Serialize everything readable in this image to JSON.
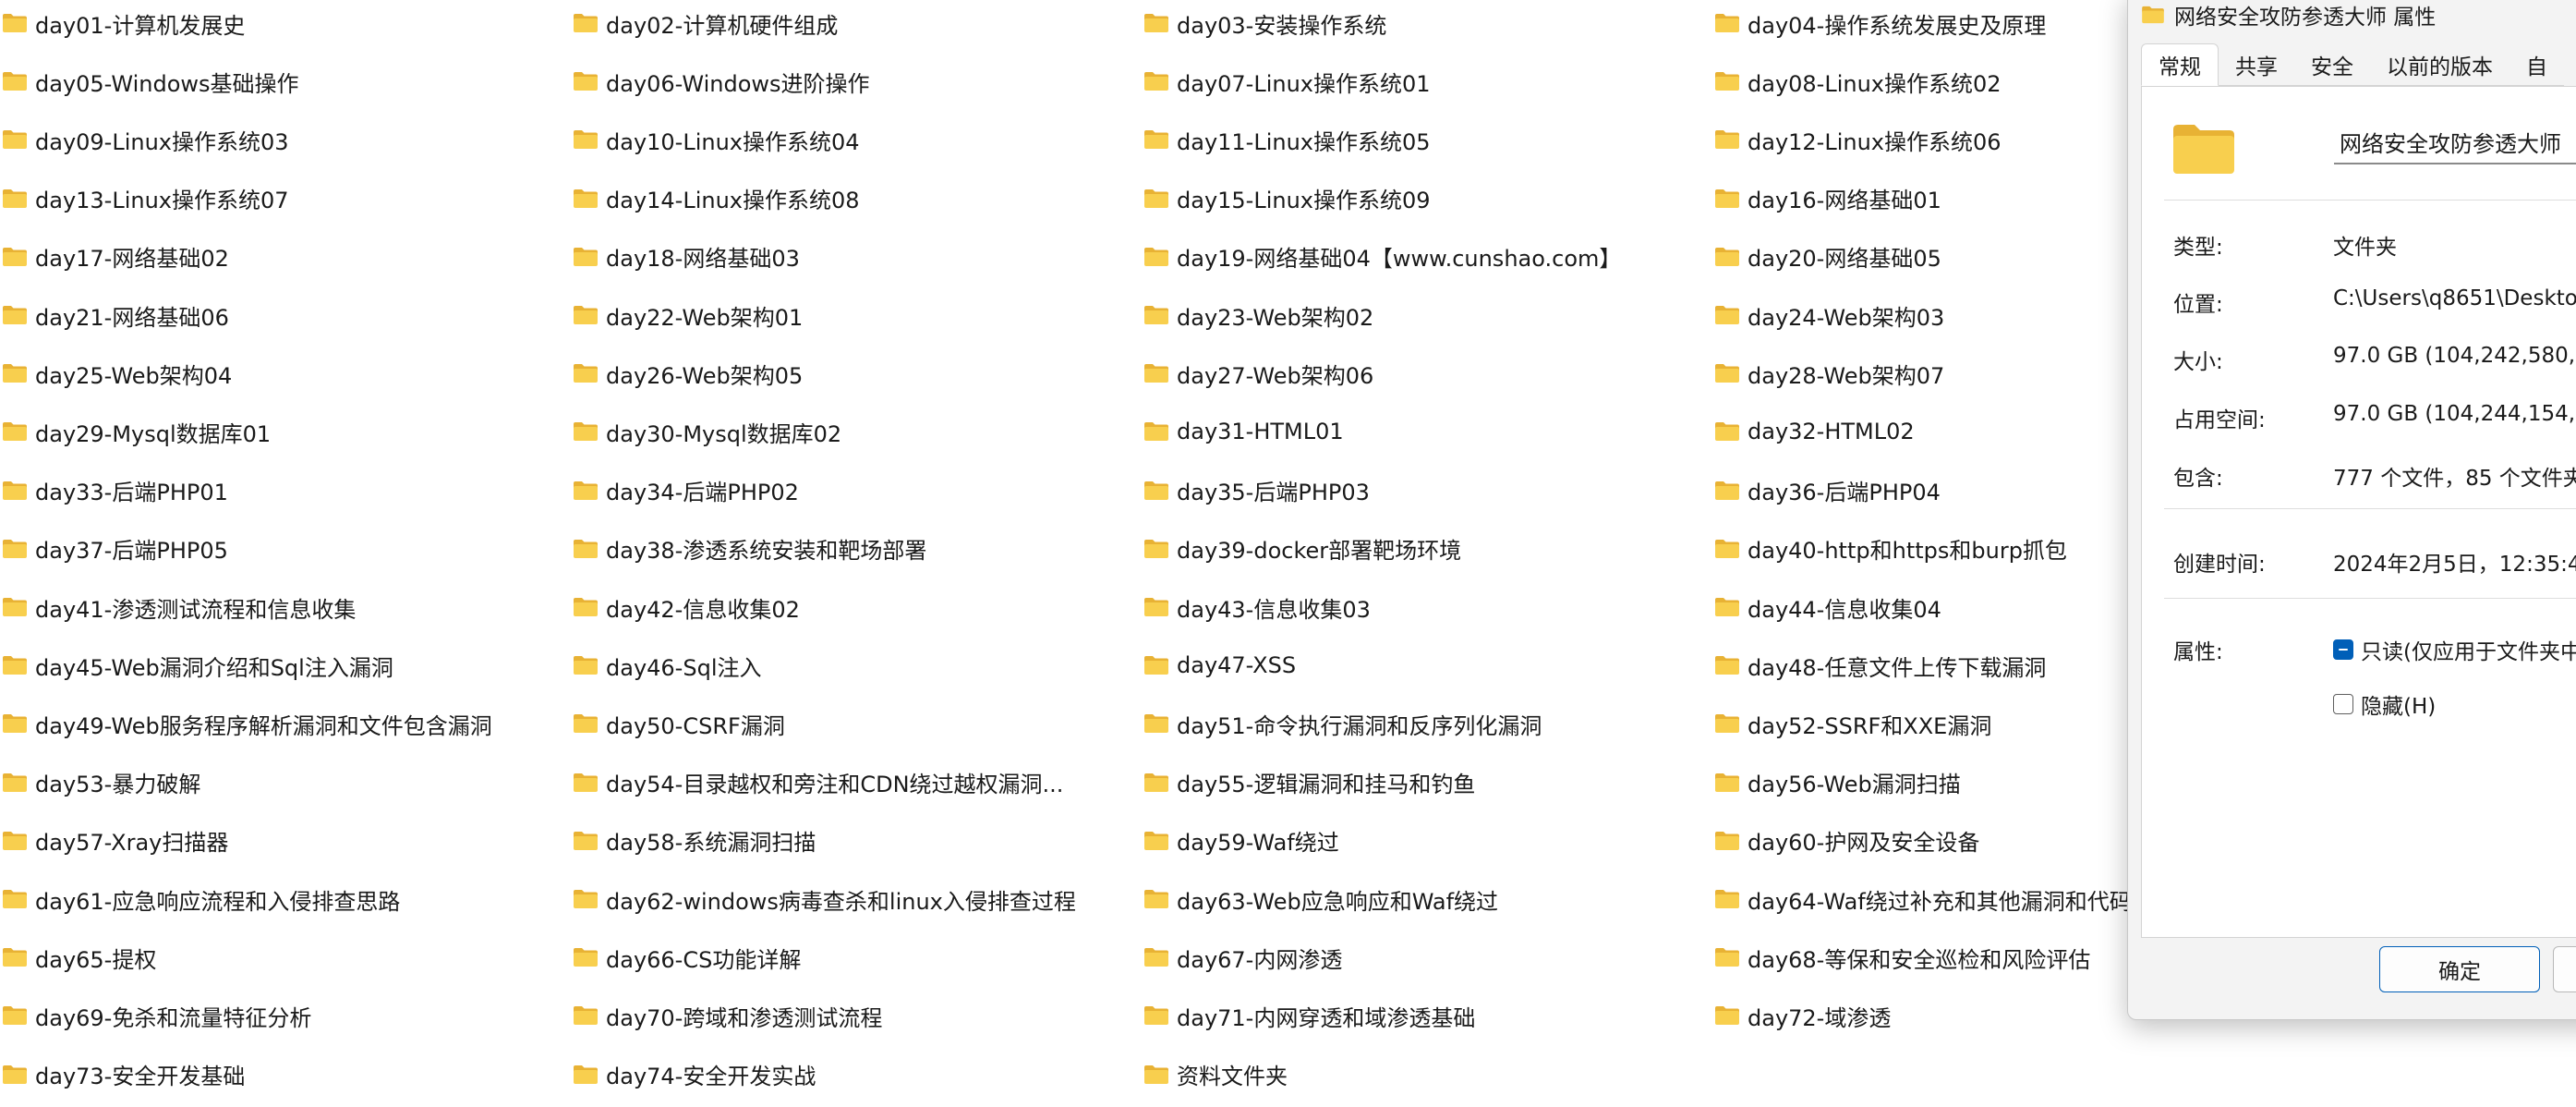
{
  "folders": [
    "day01-计算机发展史",
    "day02-计算机硬件组成",
    "day03-安装操作系统",
    "day04-操作系统发展史及原理",
    "day05-Windows基础操作",
    "day06-Windows进阶操作",
    "day07-Linux操作系统01",
    "day08-Linux操作系统02",
    "day09-Linux操作系统03",
    "day10-Linux操作系统04",
    "day11-Linux操作系统05",
    "day12-Linux操作系统06",
    "day13-Linux操作系统07",
    "day14-Linux操作系统08",
    "day15-Linux操作系统09",
    "day16-网络基础01",
    "day17-网络基础02",
    "day18-网络基础03",
    "day19-网络基础04【www.cunshao.com】",
    "day20-网络基础05",
    "day21-网络基础06",
    "day22-Web架构01",
    "day23-Web架构02",
    "day24-Web架构03",
    "day25-Web架构04",
    "day26-Web架构05",
    "day27-Web架构06",
    "day28-Web架构07",
    "day29-Mysql数据库01",
    "day30-Mysql数据库02",
    "day31-HTML01",
    "day32-HTML02",
    "day33-后端PHP01",
    "day34-后端PHP02",
    "day35-后端PHP03",
    "day36-后端PHP04",
    "day37-后端PHP05",
    "day38-渗透系统安装和靶场部署",
    "day39-docker部署靶场环境",
    "day40-http和https和burp抓包",
    "day41-渗透测试流程和信息收集",
    "day42-信息收集02",
    "day43-信息收集03",
    "day44-信息收集04",
    "day45-Web漏洞介绍和Sql注入漏洞",
    "day46-Sql注入",
    "day47-XSS",
    "day48-任意文件上传下载漏洞",
    "day49-Web服务程序解析漏洞和文件包含漏洞",
    "day50-CSRF漏洞",
    "day51-命令执行漏洞和反序列化漏洞",
    "day52-SSRF和XXE漏洞",
    "day53-暴力破解",
    "day54-目录越权和旁注和CDN绕过越权漏洞...",
    "day55-逻辑漏洞和挂马和钓鱼",
    "day56-Web漏洞扫描",
    "day57-Xray扫描器",
    "day58-系统漏洞扫描",
    "day59-Waf绕过",
    "day60-护网及安全设备",
    "day61-应急响应流程和入侵排查思路",
    "day62-windows病毒查杀和linux入侵排查过程",
    "day63-Web应急响应和Waf绕过",
    "day64-Waf绕过补充和其他漏洞和代码",
    "day65-提权",
    "day66-CS功能详解",
    "day67-内网渗透",
    "day68-等保和安全巡检和风险评估",
    "day69-免杀和流量特征分析",
    "day70-跨域和渗透测试流程",
    "day71-内网穿透和域渗透基础",
    "day72-域渗透",
    "day73-安全开发基础",
    "day74-安全开发实战",
    "资料文件夹"
  ],
  "colors": {
    "folder_body": "#F8CF4E",
    "folder_back": "#E8B234",
    "accent": "#005FB8"
  },
  "dialog": {
    "title": "网络安全攻防参透大师 属性",
    "tabs": [
      "常规",
      "共享",
      "安全",
      "以前的版本",
      "自"
    ],
    "folder_name": "网络安全攻防参透大师",
    "props": {
      "type_label": "类型:",
      "type_value": "文件夹",
      "location_label": "位置:",
      "location_value": "C:\\Users\\q8651\\Deskto",
      "size_label": "大小:",
      "size_value": "97.0 GB (104,242,580,0",
      "disk_label": "占用空间:",
      "disk_value": "97.0 GB (104,244,154,3",
      "contains_label": "包含:",
      "contains_value": "777 个文件，85 个文件夹",
      "created_label": "创建时间:",
      "created_value": "2024年2月5日，12:35:4",
      "attrs_label": "属性:",
      "readonly_label": "只读(仅应用于文件夹中",
      "hidden_label": "隐藏(H)"
    },
    "ok_label": "确定",
    "cancel_label": ""
  }
}
